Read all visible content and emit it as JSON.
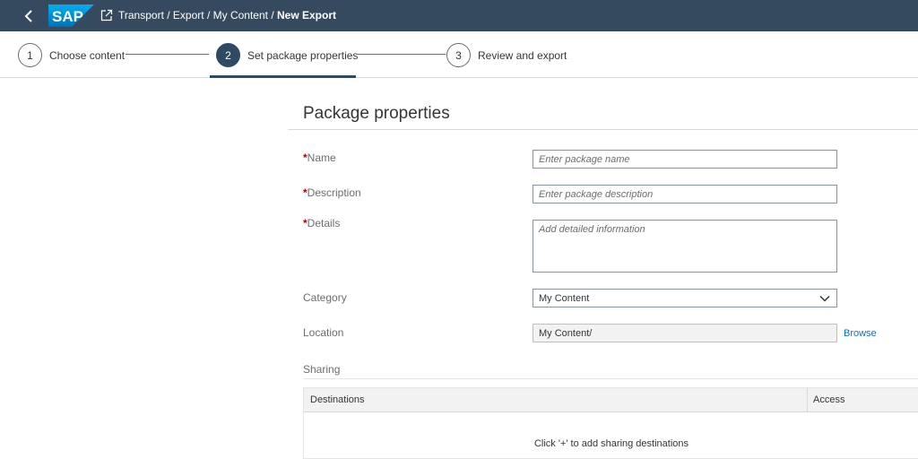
{
  "shell": {
    "logo_text": "SAP",
    "breadcrumb": {
      "transport": "Transport",
      "sep1": " / ",
      "export": "Export",
      "sep2": " / ",
      "my_content": "My Content",
      "sep3": " / ",
      "current": "New Export"
    }
  },
  "wizard": {
    "steps": [
      {
        "number": "1",
        "label": "Choose content"
      },
      {
        "number": "2",
        "label": "Set package properties"
      },
      {
        "number": "3",
        "label": "Review and export"
      }
    ],
    "active_step": 2
  },
  "form": {
    "title": "Package properties",
    "required_marker": "*",
    "name": {
      "label": "Name",
      "placeholder": "Enter package name"
    },
    "description": {
      "label": "Description",
      "placeholder": "Enter package description"
    },
    "details": {
      "label": "Details",
      "placeholder": "Add detailed information"
    },
    "category": {
      "label": "Category",
      "value": "My Content"
    },
    "location": {
      "label": "Location",
      "value": "My Content/",
      "browse_label": "Browse"
    },
    "sharing": {
      "label": "Sharing",
      "columns": [
        "Destinations",
        "Access"
      ],
      "empty_text": "Click '+' to add sharing destinations"
    }
  },
  "colors": {
    "shell_bg": "#354a5f",
    "active_step": "#2f4a63",
    "required": "#bb0000",
    "link": "#0a6ed1"
  }
}
